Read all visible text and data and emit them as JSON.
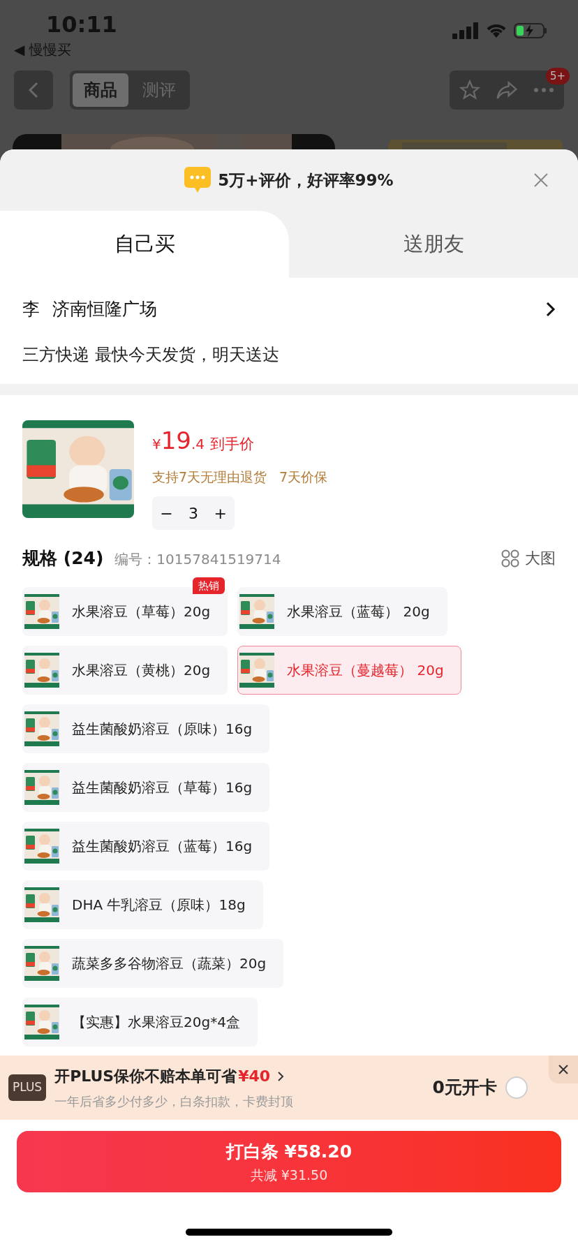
{
  "status_bar": {
    "time": "10:11",
    "back_app": "◀ 慢慢买"
  },
  "nav": {
    "segments": [
      {
        "label": "商品",
        "selected": true
      },
      {
        "label": "测评",
        "selected": false
      }
    ],
    "badge": "5+"
  },
  "banner": {
    "text": "5万+评价，好评率99%"
  },
  "tabs": [
    {
      "label": "自己买",
      "selected": true
    },
    {
      "label": "送朋友",
      "selected": false
    }
  ],
  "address": {
    "name": "李",
    "place": "济南恒隆广场",
    "delivery": "三方快递 最快今天发货，明天送达"
  },
  "product": {
    "price_symbol": "¥",
    "price_integer": "19",
    "price_decimal": ".4",
    "price_label": "到手价",
    "guarantees": [
      "支持7天无理由退货",
      "7天价保"
    ],
    "quantity": "3",
    "minus": "−",
    "plus": "+"
  },
  "specs": {
    "title": "规格 (24)",
    "code": "编号：10157841519714",
    "big_view": "大图",
    "rows": [
      [
        {
          "label": "水果溶豆（草莓）20g",
          "selected": false,
          "badge": "热销"
        },
        {
          "label": "水果溶豆（蓝莓） 20g",
          "selected": false
        }
      ],
      [
        {
          "label": "水果溶豆（黄桃）20g",
          "selected": false
        },
        {
          "label": "水果溶豆（蔓越莓） 20g",
          "selected": true
        }
      ],
      [
        {
          "label": "益生菌酸奶溶豆（原味）16g",
          "selected": false
        }
      ],
      [
        {
          "label": "益生菌酸奶溶豆（草莓）16g",
          "selected": false
        }
      ],
      [
        {
          "label": "益生菌酸奶溶豆（蓝莓）16g",
          "selected": false
        }
      ],
      [
        {
          "label": "DHA 牛乳溶豆（原味）18g",
          "selected": false
        }
      ],
      [
        {
          "label": "蔬菜多多谷物溶豆（蔬菜）20g",
          "selected": false
        }
      ],
      [
        {
          "label": "【实惠】水果溶豆20g*4盒",
          "selected": false
        }
      ]
    ]
  },
  "plus_offer": {
    "badge": "PLUS",
    "title": "开PLUS保你不赔本单可省",
    "amount": "¥40",
    "subtitle": "一年后省多少付多少，白条扣款，卡费封顶",
    "action": "0元开卡",
    "checked": false
  },
  "pay_button": {
    "label": "打白条 ¥58.20",
    "discount": "共减 ¥31.50"
  }
}
